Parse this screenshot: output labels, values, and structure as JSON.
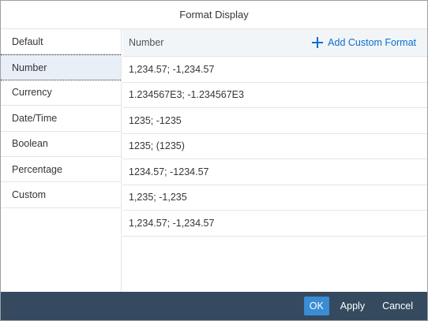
{
  "dialog": {
    "title": "Format Display"
  },
  "sidebar": {
    "items": [
      {
        "label": "Default"
      },
      {
        "label": "Number"
      },
      {
        "label": "Currency"
      },
      {
        "label": "Date/Time"
      },
      {
        "label": "Boolean"
      },
      {
        "label": "Percentage"
      },
      {
        "label": "Custom"
      }
    ],
    "selected": "Number"
  },
  "main": {
    "header_label": "Number",
    "add_label": "Add Custom Format",
    "add_icon": "plus-icon",
    "formats": [
      "1,234.57; -1,234.57",
      "1.234567E3; -1.234567E3",
      "1235; -1235",
      "1235; (1235)",
      "1234.57; -1234.57",
      "1,235; -1,235",
      "1,234.57; -1,234.57"
    ]
  },
  "footer": {
    "ok_label": "OK",
    "apply_label": "Apply",
    "cancel_label": "Cancel"
  },
  "colors": {
    "accent": "#0a6ed1",
    "footer_bg": "#354a5f",
    "primary_button": "#3a8cd4",
    "selected_bg": "#e8eff7"
  }
}
